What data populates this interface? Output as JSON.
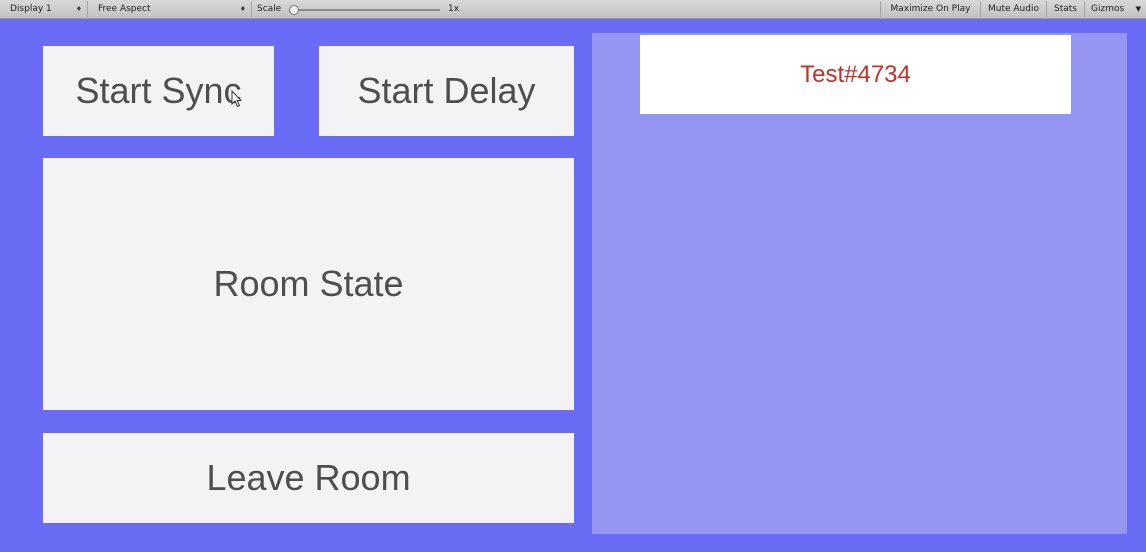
{
  "toolbar": {
    "display": "Display 1",
    "aspect": "Free Aspect",
    "scale_label": "Scale",
    "scale_value": "1x",
    "maximize_on_play": "Maximize On Play",
    "mute_audio": "Mute Audio",
    "stats": "Stats",
    "gizmos": "Gizmos"
  },
  "buttons": {
    "start_sync": "Start Sync",
    "start_delay": "Start Delay",
    "room_state": "Room State",
    "leave_room": "Leave Room"
  },
  "player": {
    "name": "Test#4734"
  },
  "colors": {
    "background": "#6a6cf6",
    "panel": "#9596f1",
    "button": "#f3f3f5",
    "name_text": "#c0312c"
  }
}
